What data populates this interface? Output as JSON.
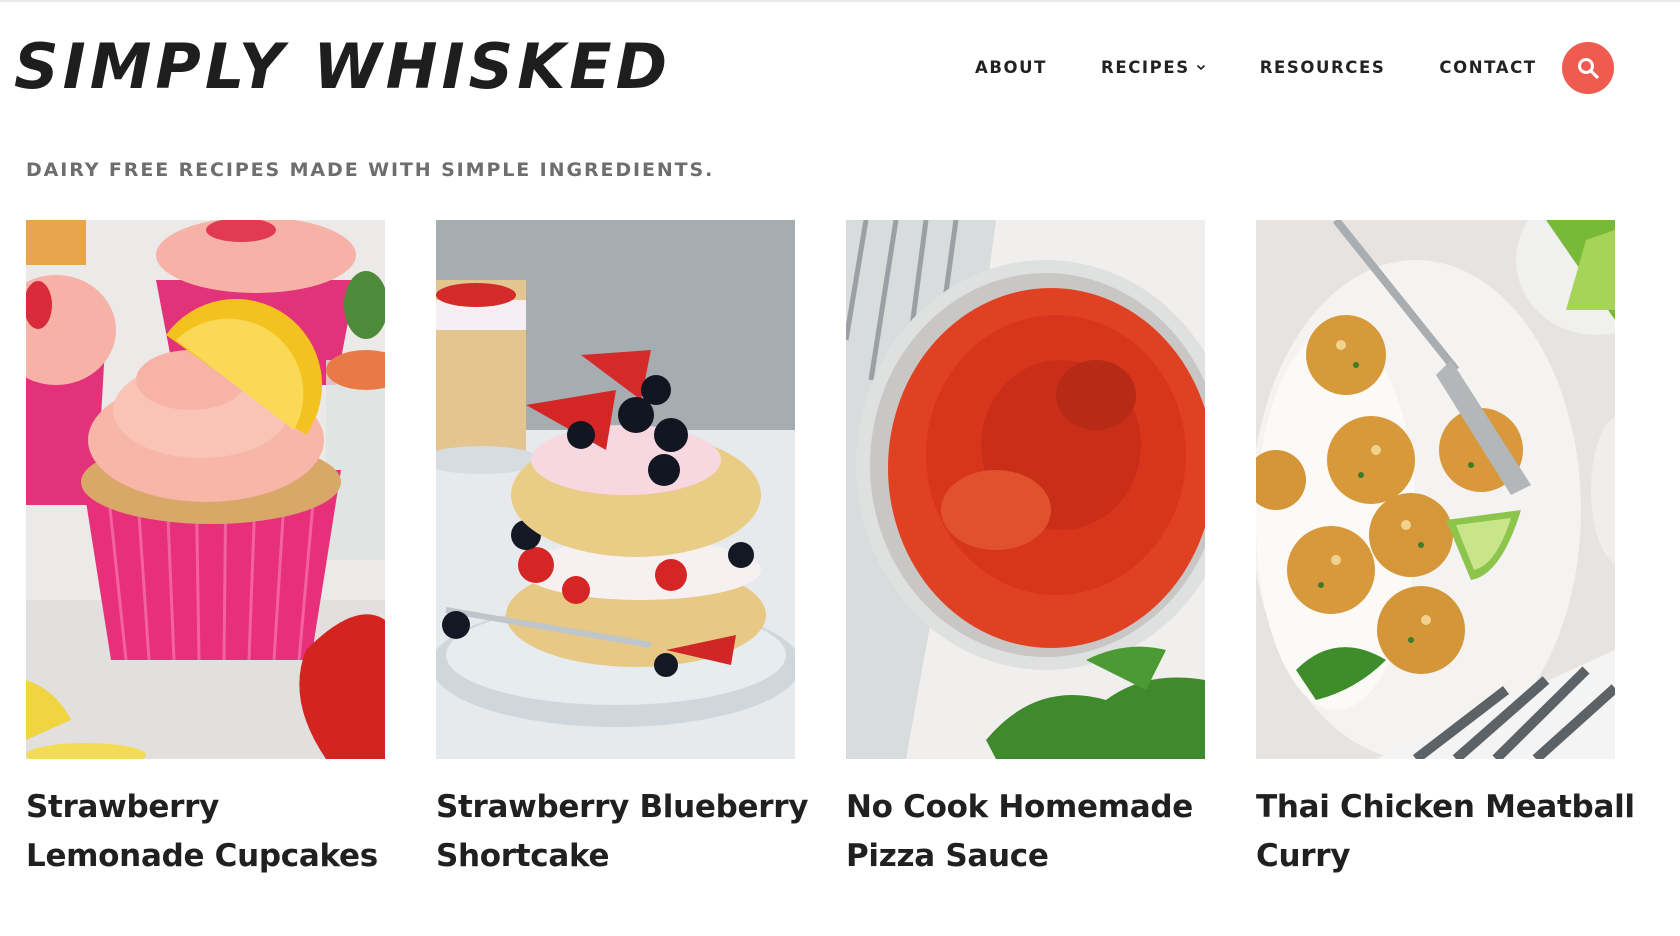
{
  "site": {
    "logo_text": "SIMPLY WHISKED",
    "logo_mark": "®",
    "tagline": "DAIRY FREE RECIPES MADE WITH SIMPLE INGREDIENTS."
  },
  "nav": {
    "items": [
      {
        "label": "ABOUT",
        "has_dropdown": false
      },
      {
        "label": "RECIPES",
        "has_dropdown": true
      },
      {
        "label": "RESOURCES",
        "has_dropdown": false
      },
      {
        "label": "CONTACT",
        "has_dropdown": false
      }
    ],
    "search_icon": "search-icon"
  },
  "colors": {
    "accent": "#f05b50",
    "text_dark": "#202020",
    "tagline_gray": "#6e6e6e"
  },
  "recipes": [
    {
      "title": "Strawberry Lemonade Cupcakes",
      "image": "cupcakes-photo"
    },
    {
      "title": "Strawberry Blueberry Shortcake",
      "image": "shortcake-photo"
    },
    {
      "title": "No Cook Homemade Pizza Sauce",
      "image": "pizza-sauce-photo"
    },
    {
      "title": "Thai Chicken Meatball Curry",
      "image": "meatball-curry-photo"
    }
  ]
}
